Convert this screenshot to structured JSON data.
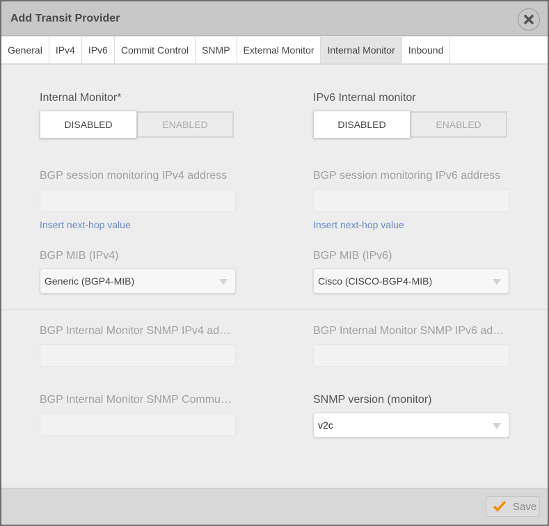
{
  "dialog": {
    "title": "Add Transit Provider",
    "close_icon": "close-icon"
  },
  "tabs": [
    {
      "label": "General",
      "active": false
    },
    {
      "label": "IPv4",
      "active": false
    },
    {
      "label": "IPv6",
      "active": false
    },
    {
      "label": "Commit Control",
      "active": false
    },
    {
      "label": "SNMP",
      "active": false
    },
    {
      "label": "External Monitor",
      "active": false
    },
    {
      "label": "Internal Monitor",
      "active": true
    },
    {
      "label": "Inbound",
      "active": false
    }
  ],
  "form": {
    "internal_monitor": {
      "label": "Internal Monitor*",
      "options": [
        "DISABLED",
        "ENABLED"
      ],
      "selected": "DISABLED"
    },
    "ipv6_internal_monitor": {
      "label": "IPv6 Internal monitor",
      "options": [
        "DISABLED",
        "ENABLED"
      ],
      "selected": "DISABLED"
    },
    "bgp_session_ipv4": {
      "label": "BGP session monitoring IPv4 address",
      "value": "",
      "link": "Insert next-hop value"
    },
    "bgp_session_ipv6": {
      "label": "BGP session monitoring IPv6 address",
      "value": "",
      "link": "Insert next-hop value"
    },
    "bgp_mib_ipv4": {
      "label": "BGP MIB (IPv4)",
      "selected": "Generic (BGP4-MIB)"
    },
    "bgp_mib_ipv6": {
      "label": "BGP MIB (IPv6)",
      "selected": "Cisco (CISCO-BGP4-MIB)"
    },
    "snmp_ipv4_addr": {
      "label": "BGP Internal Monitor SNMP IPv4 addr…",
      "value": ""
    },
    "snmp_ipv6_addr": {
      "label": "BGP Internal Monitor SNMP IPv6 addr…",
      "value": ""
    },
    "snmp_community": {
      "label": "BGP Internal Monitor SNMP Community",
      "value": ""
    },
    "snmp_version": {
      "label": "SNMP version (monitor)",
      "selected": "v2c"
    }
  },
  "footer": {
    "save_label": "Save",
    "save_icon": "checkmark-icon",
    "accent_color": "#f08c00"
  }
}
